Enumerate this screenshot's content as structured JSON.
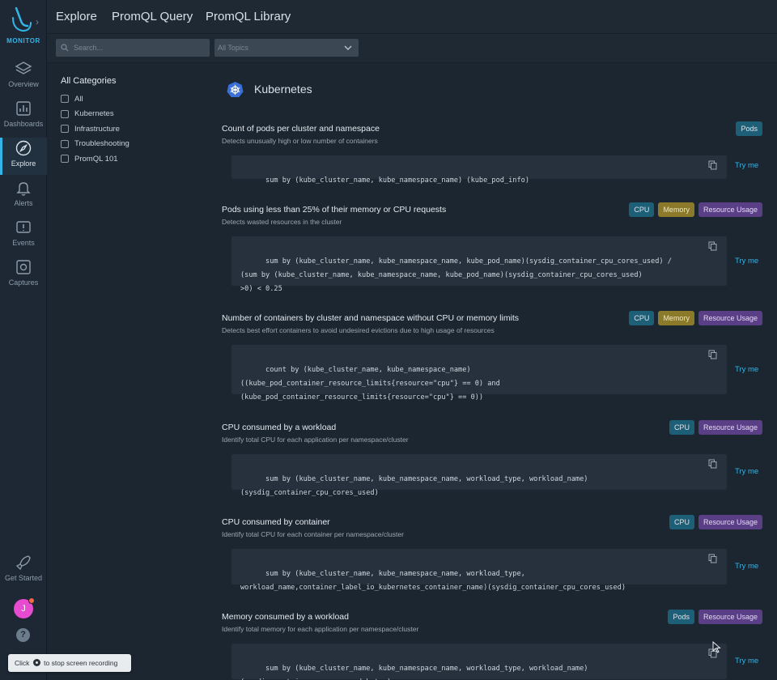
{
  "app": {
    "brand": "MONITOR"
  },
  "nav": {
    "items": [
      {
        "label": "Overview",
        "icon": "layers-icon"
      },
      {
        "label": "Dashboards",
        "icon": "bar-chart-icon"
      },
      {
        "label": "Explore",
        "icon": "compass-icon",
        "active": true
      },
      {
        "label": "Alerts",
        "icon": "bell-icon"
      },
      {
        "label": "Events",
        "icon": "events-icon"
      },
      {
        "label": "Captures",
        "icon": "capture-icon"
      }
    ],
    "get_started": "Get Started",
    "avatar_initial": "J",
    "help": "?"
  },
  "header": {
    "tabs": [
      "Explore",
      "PromQL Query",
      "PromQL Library"
    ]
  },
  "toolbar": {
    "search_placeholder": "Search...",
    "topics_value": "All Topics"
  },
  "categories": {
    "title": "All Categories",
    "items": [
      "All",
      "Kubernetes",
      "Infrastructure",
      "Troubleshooting",
      "PromQL 101"
    ]
  },
  "section": {
    "title": "Kubernetes"
  },
  "queries": [
    {
      "title": "Count of pods per cluster and namespace",
      "desc": "Detects unusually high or low number of containers",
      "tags": [
        "Pods"
      ],
      "code": "sum by (kube_cluster_name, kube_namespace_name) (kube_pod_info)",
      "try": "Try me"
    },
    {
      "title": "Pods using less than 25% of their memory or CPU requests",
      "desc": "Detects wasted resources in the cluster",
      "tags": [
        "CPU",
        "Memory",
        "Resource Usage"
      ],
      "code": "sum by (kube_cluster_name, kube_namespace_name, kube_pod_name)(sysdig_container_cpu_cores_used) /\n(sum by (kube_cluster_name, kube_namespace_name, kube_pod_name)(sysdig_container_cpu_cores_used)\n>0) < 0.25",
      "try": "Try me"
    },
    {
      "title": "Number of containers by cluster and namespace without CPU or memory limits",
      "desc": "Detects best effort containers to avoid undesired evictions due to high usage of resources",
      "tags": [
        "CPU",
        "Memory",
        "Resource Usage"
      ],
      "code": "count by (kube_cluster_name, kube_namespace_name)\n((kube_pod_container_resource_limits{resource=\"cpu\"} == 0) and\n(kube_pod_container_resource_limits{resource=\"cpu\"} == 0))",
      "try": "Try me"
    },
    {
      "title": "CPU consumed by a workload",
      "desc": "Identify total CPU for each application per namespace/cluster",
      "tags": [
        "CPU",
        "Resource Usage"
      ],
      "code": "sum by (kube_cluster_name, kube_namespace_name, workload_type, workload_name)\n(sysdig_container_cpu_cores_used)",
      "try": "Try me"
    },
    {
      "title": "CPU consumed by container",
      "desc": "Identify total CPU for each container per namespace/cluster",
      "tags": [
        "CPU",
        "Resource Usage"
      ],
      "code": "sum by (kube_cluster_name, kube_namespace_name, workload_type,\nworkload_name,container_label_io_kubernetes_container_name)(sysdig_container_cpu_cores_used)",
      "try": "Try me"
    },
    {
      "title": "Memory consumed by a workload",
      "desc": "Identify total memory for each application per namespace/cluster",
      "tags": [
        "Pods",
        "Resource Usage"
      ],
      "code": "sum by (kube_cluster_name, kube_namespace_name, workload_type, workload_name)\n(sysdig_container_memory_used_bytes)",
      "try": "Try me"
    }
  ],
  "toast": {
    "before": "Click",
    "after": "to stop screen recording"
  },
  "colors": {
    "accent": "#35b4e6",
    "cpu_tag": "#1d5f77",
    "memory_tag": "#8a7a2a",
    "resource_tag": "#5b3f86"
  }
}
